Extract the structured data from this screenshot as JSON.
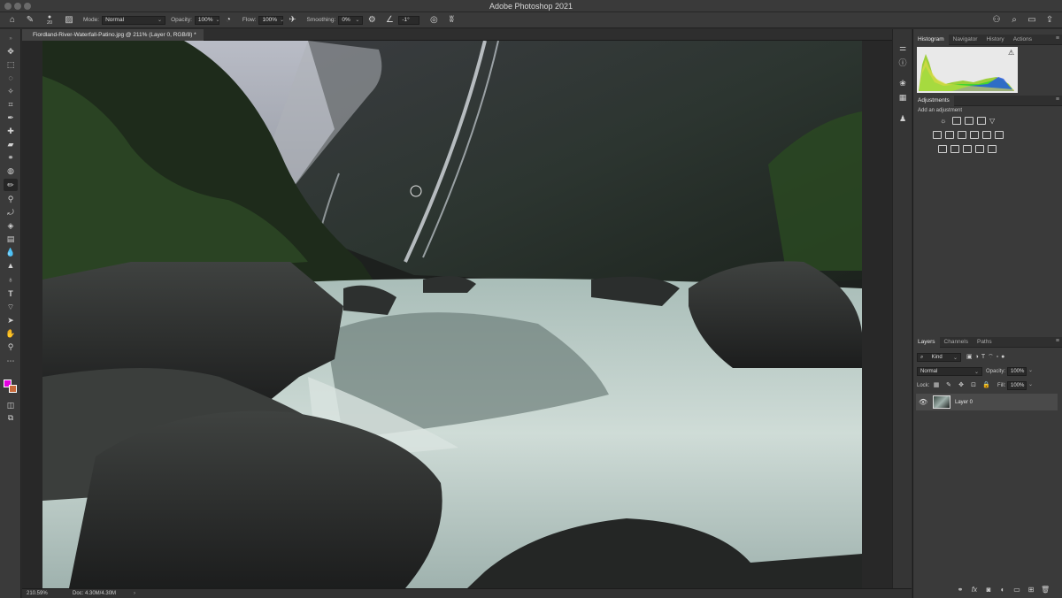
{
  "window": {
    "title": "Adobe Photoshop 2021"
  },
  "options_bar": {
    "brush_size": "20",
    "mode_label": "Mode:",
    "mode_value": "Normal",
    "opacity_label": "Opacity:",
    "opacity_value": "100%",
    "flow_label": "Flow:",
    "flow_value": "100%",
    "smoothing_label": "Smoothing:",
    "smoothing_value": "0%",
    "angle_value": "-1°"
  },
  "document": {
    "tab_title": "Fiordland-River-Waterfall-Patino.jpg @ 211% (Layer 0, RGB/8) *",
    "close_glyph": "×"
  },
  "status_bar": {
    "zoom": "210.59%",
    "doc_info": "Doc: 4.30M/4.30M",
    "arrow": "›"
  },
  "histogram_panel": {
    "tabs": [
      "Histogram",
      "Navigator",
      "History",
      "Actions"
    ],
    "active_tab": "Histogram",
    "warning_glyph": "⚠"
  },
  "adjustments_panel": {
    "tab": "Adjustments",
    "hint": "Add an adjustment"
  },
  "layers_panel": {
    "tabs": [
      "Layers",
      "Channels",
      "Paths"
    ],
    "active_tab": "Layers",
    "filter_value": "Kind",
    "blend_mode": "Normal",
    "opacity_label": "Opacity:",
    "opacity_value": "100%",
    "lock_label": "Lock:",
    "fill_label": "Fill:",
    "fill_value": "100%",
    "layers": [
      {
        "name": "Layer 0",
        "visible": true
      }
    ],
    "footer_icons": [
      "link-icon",
      "fx-icon",
      "mask-icon",
      "adjustment-icon",
      "group-icon",
      "new-layer-icon",
      "trash-icon"
    ]
  },
  "colors": {
    "foreground": "#e400e0",
    "background": "#c86a3a",
    "ui_dark": "#2b2b2b",
    "ui_panel": "#3a3a3a"
  }
}
